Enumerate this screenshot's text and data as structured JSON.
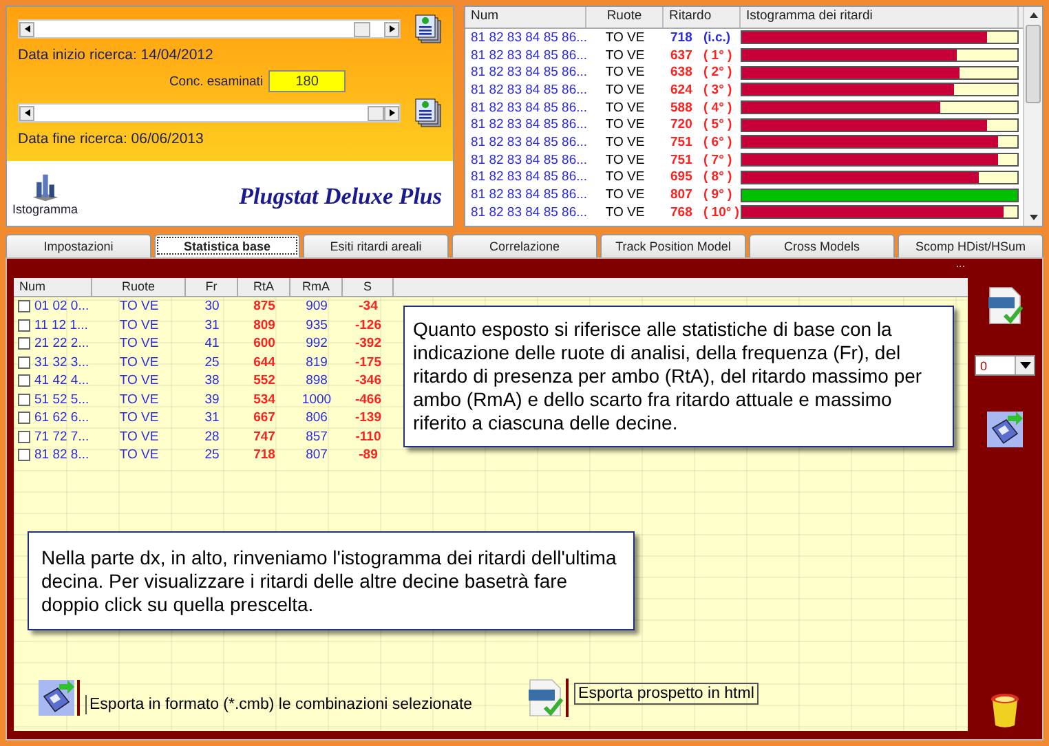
{
  "range_panel": {
    "start_slider": {
      "level": 0.96
    },
    "start_label": "Data inizio ricerca: 14/04/2012",
    "count_label": "Conc. esaminati",
    "count_value": "180",
    "end_slider": {
      "level": 1
    },
    "end_label": "Data fine ricerca: 06/06/2013",
    "histogram_button": "Istogramma",
    "logo": "Plugstat Deluxe Plus"
  },
  "delay_grid": {
    "columns": [
      "Num",
      "Ruote",
      "Ritardo",
      "Istogramma dei ritardi"
    ],
    "rows": [
      {
        "num": "81 82 83 84 85 86...",
        "ruote": "TO VE",
        "ritardo": "718",
        "rank": "(i.c.)",
        "kind": "current",
        "level": 0.89,
        "color": "#c8003a"
      },
      {
        "num": "81 82 83 84 85 86...",
        "ruote": "TO VE",
        "ritardo": "637",
        "rank": "( 1° )",
        "kind": "past",
        "level": 0.78,
        "color": "#c8003a"
      },
      {
        "num": "81 82 83 84 85 86...",
        "ruote": "TO VE",
        "ritardo": "638",
        "rank": "( 2° )",
        "kind": "past",
        "level": 0.79,
        "color": "#c8003a"
      },
      {
        "num": "81 82 83 84 85 86...",
        "ruote": "TO VE",
        "ritardo": "624",
        "rank": "( 3° )",
        "kind": "past",
        "level": 0.77,
        "color": "#c8003a"
      },
      {
        "num": "81 82 83 84 85 86...",
        "ruote": "TO VE",
        "ritardo": "588",
        "rank": "( 4° )",
        "kind": "past",
        "level": 0.72,
        "color": "#c8003a"
      },
      {
        "num": "81 82 83 84 85 86...",
        "ruote": "TO VE",
        "ritardo": "720",
        "rank": "( 5° )",
        "kind": "past",
        "level": 0.89,
        "color": "#c8003a"
      },
      {
        "num": "81 82 83 84 85 86...",
        "ruote": "TO VE",
        "ritardo": "751",
        "rank": "( 6° )",
        "kind": "past",
        "level": 0.93,
        "color": "#c8003a"
      },
      {
        "num": "81 82 83 84 85 86...",
        "ruote": "TO VE",
        "ritardo": "751",
        "rank": "( 7° )",
        "kind": "past",
        "level": 0.93,
        "color": "#c8003a"
      },
      {
        "num": "81 82 83 84 85 86...",
        "ruote": "TO VE",
        "ritardo": "695",
        "rank": "( 8° )",
        "kind": "past",
        "level": 0.86,
        "color": "#c8003a"
      },
      {
        "num": "81 82 83 84 85 86...",
        "ruote": "TO VE",
        "ritardo": "807",
        "rank": "( 9° )",
        "kind": "past",
        "level": 1,
        "color": "#00c000"
      },
      {
        "num": "81 82 83 84 85 86...",
        "ruote": "TO VE",
        "ritardo": "768",
        "rank": "( 10° )",
        "kind": "past",
        "level": 0.95,
        "color": "#c8003a"
      }
    ]
  },
  "tabs": [
    {
      "label": "Impostazioni",
      "selected": false
    },
    {
      "label": "Statistica base",
      "selected": true
    },
    {
      "label": "Esiti ritardi areali",
      "selected": false
    },
    {
      "label": "Correlazione",
      "selected": false
    },
    {
      "label": "Track Position Model",
      "selected": false
    },
    {
      "label": "Cross Models",
      "selected": false
    },
    {
      "label": "Scomp HDist/HSum",
      "selected": false
    }
  ],
  "ellipsis": "...",
  "stats_table": {
    "columns": [
      "Num",
      "Ruote",
      "Fr",
      "RtA",
      "RmA",
      "S"
    ],
    "rows": [
      {
        "checked": false,
        "num": "01 02 0...",
        "ruote": "TO VE",
        "fr": "30",
        "rta": "875",
        "rma": "909",
        "s": "-34"
      },
      {
        "checked": false,
        "num": "11 12 1...",
        "ruote": "TO VE",
        "fr": "31",
        "rta": "809",
        "rma": "935",
        "s": "-126"
      },
      {
        "checked": false,
        "num": "21 22 2...",
        "ruote": "TO VE",
        "fr": "41",
        "rta": "600",
        "rma": "992",
        "s": "-392"
      },
      {
        "checked": false,
        "num": "31 32 3...",
        "ruote": "TO VE",
        "fr": "25",
        "rta": "644",
        "rma": "819",
        "s": "-175"
      },
      {
        "checked": false,
        "num": "41 42 4...",
        "ruote": "TO VE",
        "fr": "38",
        "rta": "552",
        "rma": "898",
        "s": "-346"
      },
      {
        "checked": false,
        "num": "51 52 5...",
        "ruote": "TO VE",
        "fr": "39",
        "rta": "534",
        "rma": "1000",
        "s": "-466"
      },
      {
        "checked": false,
        "num": "61 62 6...",
        "ruote": "TO VE",
        "fr": "31",
        "rta": "667",
        "rma": "806",
        "s": "-139"
      },
      {
        "checked": false,
        "num": "71 72 7...",
        "ruote": "TO VE",
        "fr": "28",
        "rta": "747",
        "rma": "857",
        "s": "-110"
      },
      {
        "checked": false,
        "num": "81 82 8...",
        "ruote": "TO VE",
        "fr": "25",
        "rta": "718",
        "rma": "807",
        "s": "-89"
      }
    ]
  },
  "callouts": [
    "Quanto esposto si riferisce alle statistiche di base con la indicazione delle ruote di analisi, della frequenza (Fr), del ritardo di presenza per ambo (RtA), del ritardo massimo per ambo (RmA) e dello scarto fra ritardo attuale e massimo riferito a ciascuna delle decine.",
    "Nella parte dx, in alto, rinveniamo l'istogramma dei ritardi dell'ultima decina. Per visualizzare i ritardi delle altre decine basetrà fare doppio click su quella prescelta."
  ],
  "decade_select": {
    "value": "0"
  },
  "export_cmb_label": "Esporta in formato (*.cmb) le combinazioni selezionate",
  "export_html_label": "Esporta prospetto in html"
}
